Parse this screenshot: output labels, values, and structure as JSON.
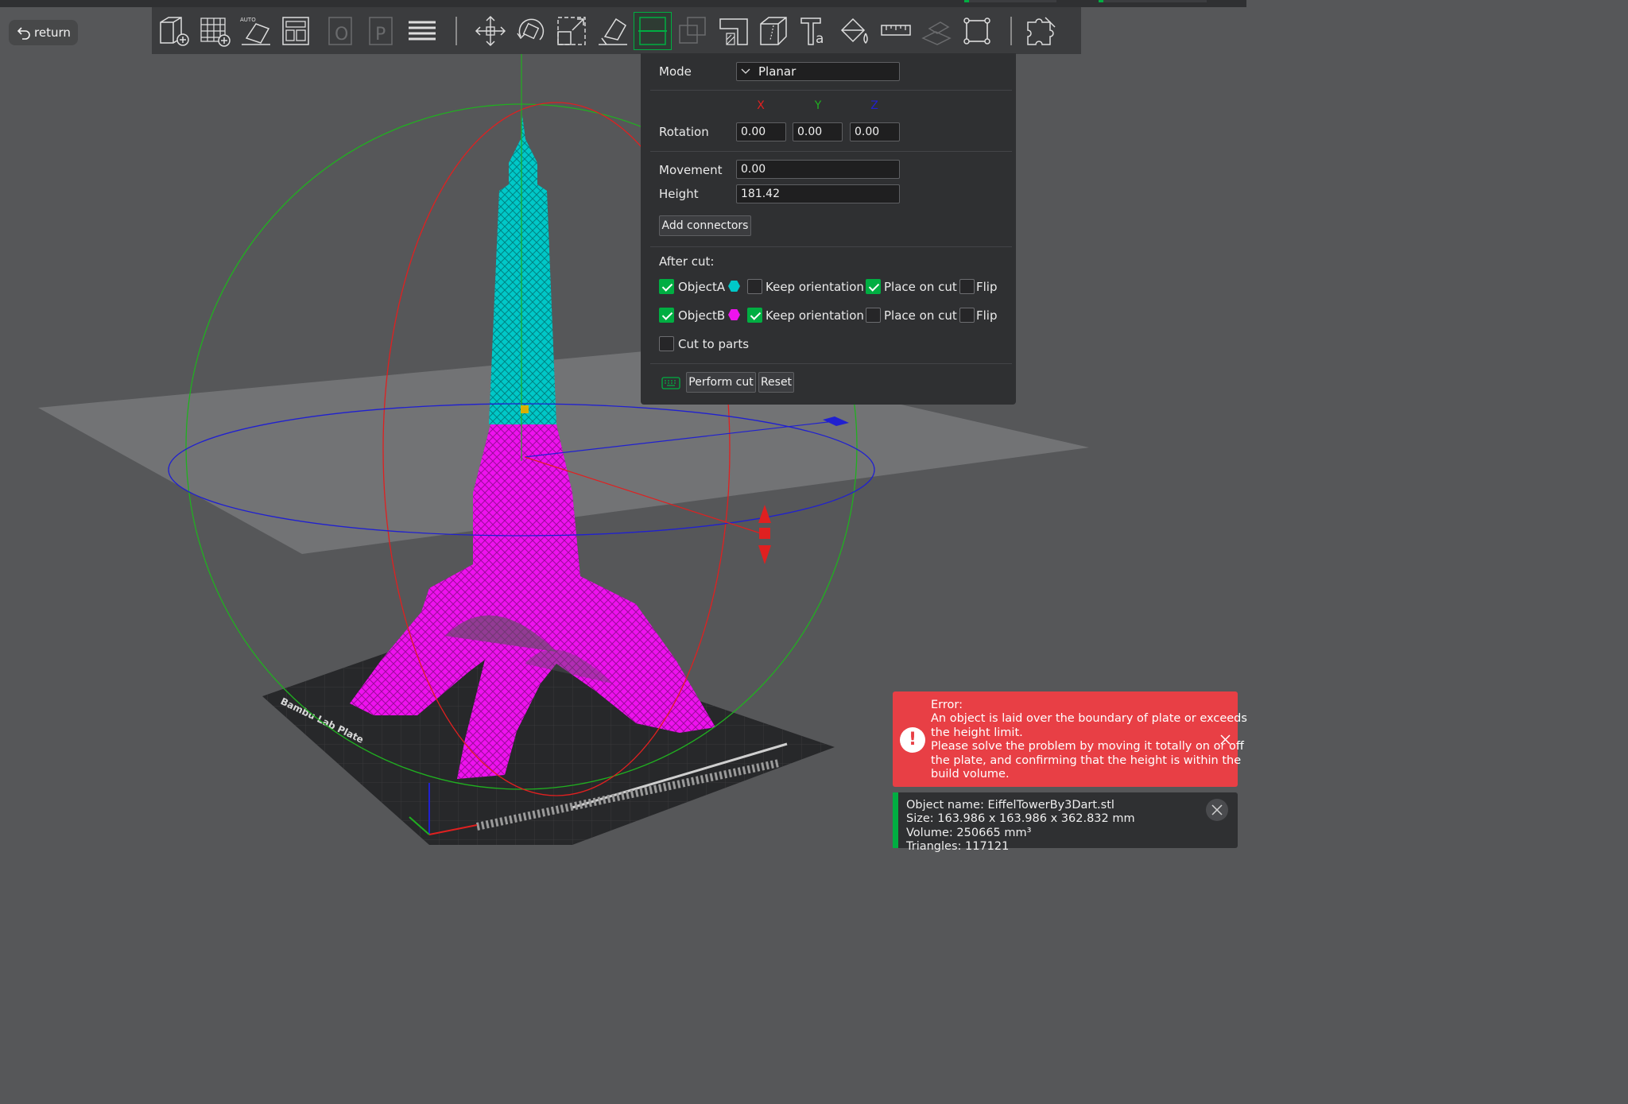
{
  "colors": {
    "accent": "#00ae42",
    "objectA": "#00c8c8",
    "objectB": "#ee12ee",
    "error_bg": "#e83f45",
    "axis_x": "#e02020",
    "axis_y": "#20b020",
    "axis_z": "#2020d0"
  },
  "nav": {
    "return_label": "return"
  },
  "toolbar": {
    "items": [
      {
        "name": "add-object-icon",
        "enabled": true
      },
      {
        "name": "add-plate-icon",
        "enabled": true
      },
      {
        "name": "auto-orient-icon",
        "enabled": true
      },
      {
        "name": "arrange-icon",
        "enabled": true
      },
      {
        "name": "split-to-objects-icon",
        "enabled": false
      },
      {
        "name": "split-to-parts-icon",
        "enabled": false
      },
      {
        "name": "layers-icon",
        "enabled": true
      },
      {
        "name": "move-icon",
        "enabled": true
      },
      {
        "name": "rotate-icon",
        "enabled": true
      },
      {
        "name": "scale-icon",
        "enabled": true
      },
      {
        "name": "lay-on-face-icon",
        "enabled": true
      },
      {
        "name": "cut-icon",
        "enabled": true,
        "active": true
      },
      {
        "name": "boolean-icon",
        "enabled": false
      },
      {
        "name": "support-paint-icon",
        "enabled": true
      },
      {
        "name": "seam-paint-icon",
        "enabled": true
      },
      {
        "name": "text-icon",
        "enabled": true
      },
      {
        "name": "color-paint-icon",
        "enabled": true
      },
      {
        "name": "measure-icon",
        "enabled": true
      },
      {
        "name": "assembly-icon",
        "enabled": false
      },
      {
        "name": "bounding-box-icon",
        "enabled": true
      },
      {
        "name": "plugin-icon",
        "enabled": true
      }
    ]
  },
  "cut_panel": {
    "mode_label": "Mode",
    "mode_value": "Planar",
    "axis_x": "X",
    "axis_y": "Y",
    "axis_z": "Z",
    "rotation_label": "Rotation",
    "rotation_x": "0.00",
    "rotation_y": "0.00",
    "rotation_z": "0.00",
    "movement_label": "Movement",
    "movement_value": "0.00",
    "height_label": "Height",
    "height_value": "181.42",
    "add_connectors": "Add connectors",
    "after_cut_label": "After cut:",
    "objectA_label": "ObjectA",
    "objectB_label": "ObjectB",
    "keep_orientation": "Keep orientation",
    "place_on_cut": "Place on cut",
    "flip": "Flip",
    "cut_to_parts": "Cut to parts",
    "perform_cut": "Perform cut",
    "reset": "Reset",
    "checks": {
      "objectA": true,
      "objectA_keep": false,
      "objectA_place": true,
      "objectA_flip": false,
      "objectB": true,
      "objectB_keep": true,
      "objectB_place": false,
      "objectB_flip": false,
      "cut_to_parts": false
    }
  },
  "error": {
    "title": "Error:",
    "line1": "An object is laid over the boundary of plate or exceeds",
    "line2": "the height limit.",
    "line3": "Please solve the problem by moving it totally on or off",
    "line4": "the plate, and confirming that the height is within the",
    "line5": "build volume."
  },
  "object_info": {
    "name_line": "Object name: EiffelTowerBy3Dart.stl",
    "size_line": "Size: 163.986 x 163.986 x 362.832 mm",
    "volume_line": "Volume: 250665 mm³",
    "triangles_line": "Triangles: 117121"
  },
  "plate": {
    "label": "Bambu Lab Plate"
  }
}
